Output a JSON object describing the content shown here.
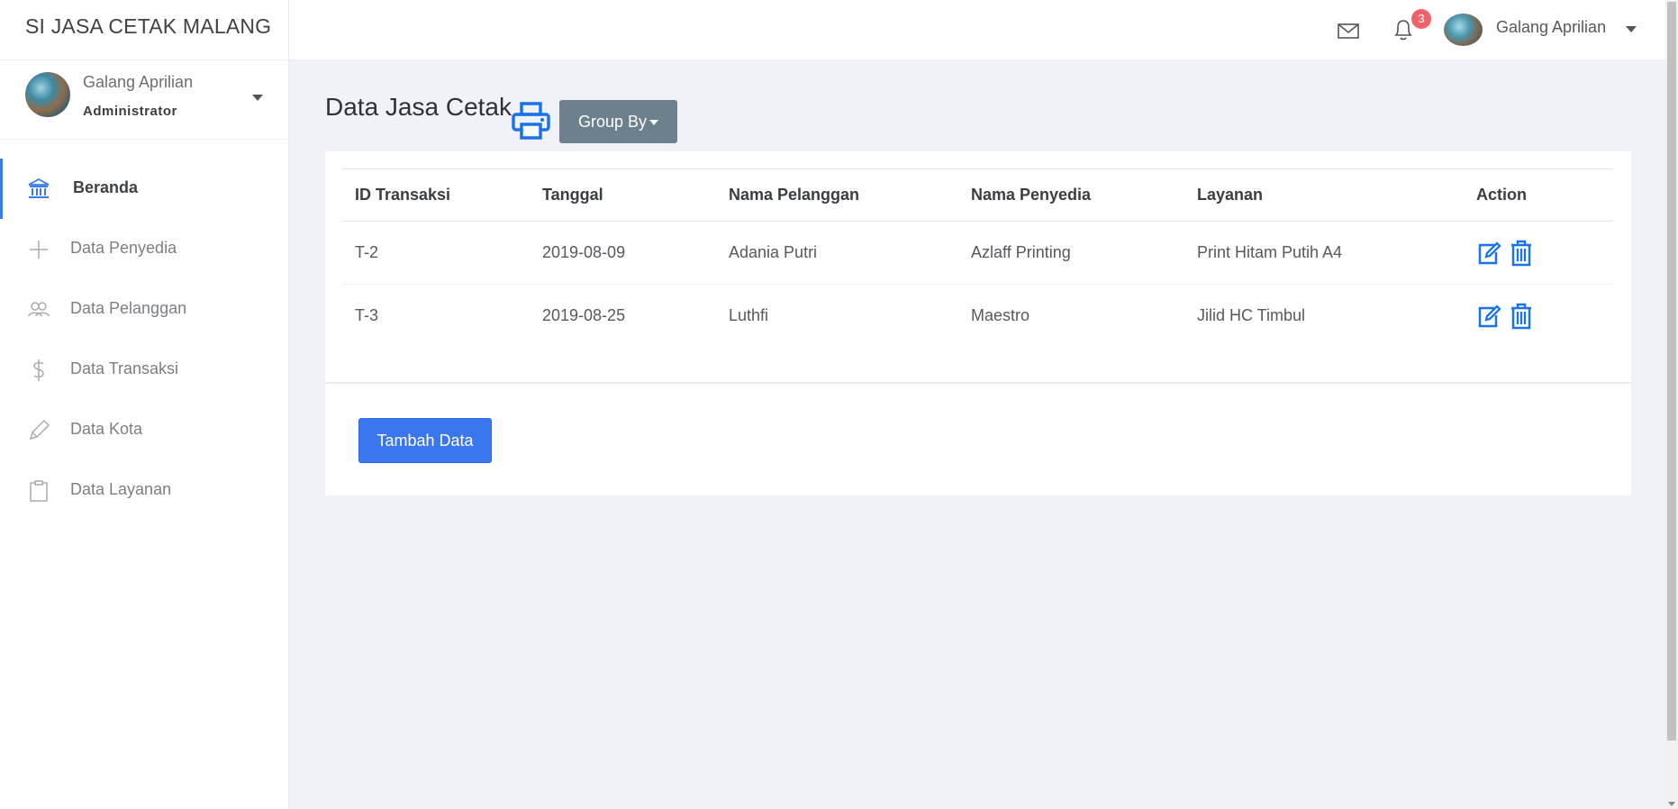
{
  "brand": "SI JASA CETAK MALANG",
  "profile": {
    "name": "Galang Aprilian",
    "role": "Administrator"
  },
  "nav": [
    {
      "label": "Beranda",
      "icon": "bank-icon",
      "active": true
    },
    {
      "label": "Data Penyedia",
      "icon": "plus-icon"
    },
    {
      "label": "Data Pelanggan",
      "icon": "users-icon"
    },
    {
      "label": "Data Transaksi",
      "icon": "dollar-icon"
    },
    {
      "label": "Data Kota",
      "icon": "pencil-icon"
    },
    {
      "label": "Data Layanan",
      "icon": "clipboard-icon"
    }
  ],
  "topbar": {
    "notif_count": "3",
    "user_name": "Galang Aprilian"
  },
  "main": {
    "title": "Data Jasa Cetak",
    "group_by_label": "Group By",
    "add_label": "Tambah Data",
    "table": {
      "headers": [
        "ID Transaksi",
        "Tanggal",
        "Nama Pelanggan",
        "Nama Penyedia",
        "Layanan",
        "Action"
      ],
      "rows": [
        [
          "T-2",
          "2019-08-09",
          "Adania Putri",
          "Azlaff Printing",
          "Print Hitam Putih A4"
        ],
        [
          "T-3",
          "2019-08-25",
          "Luthfi",
          "Maestro",
          "Jilid HC Timbul"
        ]
      ]
    }
  },
  "colors": {
    "accent": "#3b7de8",
    "primary_button": "#3a76ee",
    "group_button": "#6c808e",
    "badge": "#f0616c",
    "icon_blue": "#1a73e8"
  }
}
